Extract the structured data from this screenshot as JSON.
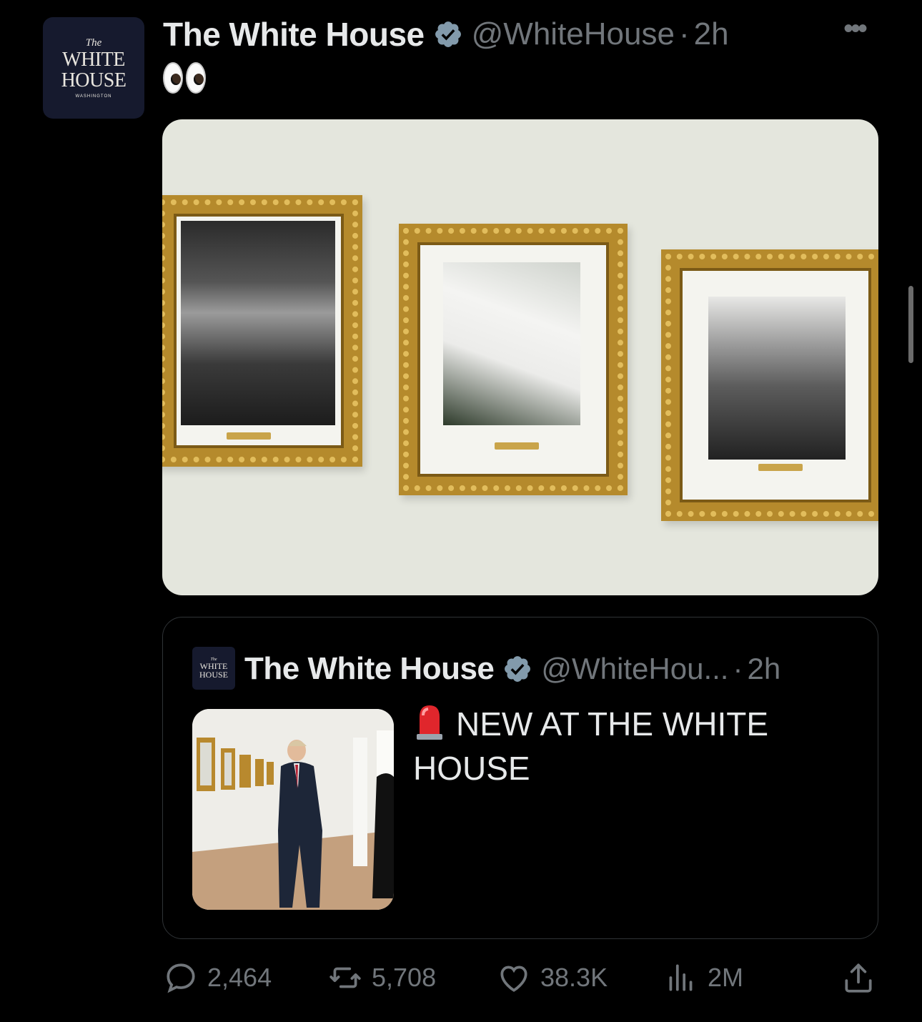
{
  "tweet": {
    "author": {
      "name": "The White House",
      "handle": "@WhiteHouse",
      "time": "2h",
      "avatar_text": {
        "the": "The",
        "line1": "WHITE",
        "line2": "HOUSE",
        "sub": "WASHINGTON"
      }
    },
    "text_emoji": "eyes-emoji",
    "more_icon": "more-icon",
    "verified_color": "#829aab"
  },
  "quote": {
    "author": {
      "name": "The White House",
      "handle": "@WhiteHou...",
      "time": "2h"
    },
    "text": "NEW AT THE WHITE HOUSE",
    "emoji": "rotating-light-emoji"
  },
  "actions": {
    "replies": "2,464",
    "reposts": "5,708",
    "likes": "38.3K",
    "views": "2M"
  }
}
